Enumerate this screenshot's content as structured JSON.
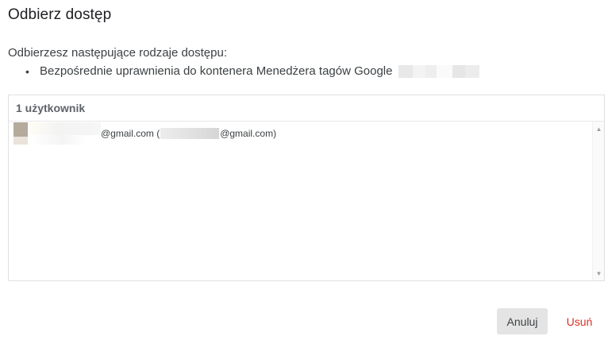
{
  "dialog": {
    "title": "Odbierz dostęp",
    "intro": "Odbierzesz następujące rodzaje dostępu:",
    "bullet_dot": "•",
    "bullet_text": "Bezpośrednie uprawnienia do kontenera Menedżera tagów Google"
  },
  "panel": {
    "header": "1 użytkownik",
    "user": {
      "email_suffix": "@gmail.com (",
      "email_suffix2": "@gmail.com)"
    },
    "scroll_up": "▲",
    "scroll_down": "▼"
  },
  "buttons": {
    "cancel_label": "Anuluj",
    "remove_label": "Usuń"
  },
  "colors": {
    "remove_text": "#d93025",
    "cancel_bg": "#e4e4e4"
  }
}
